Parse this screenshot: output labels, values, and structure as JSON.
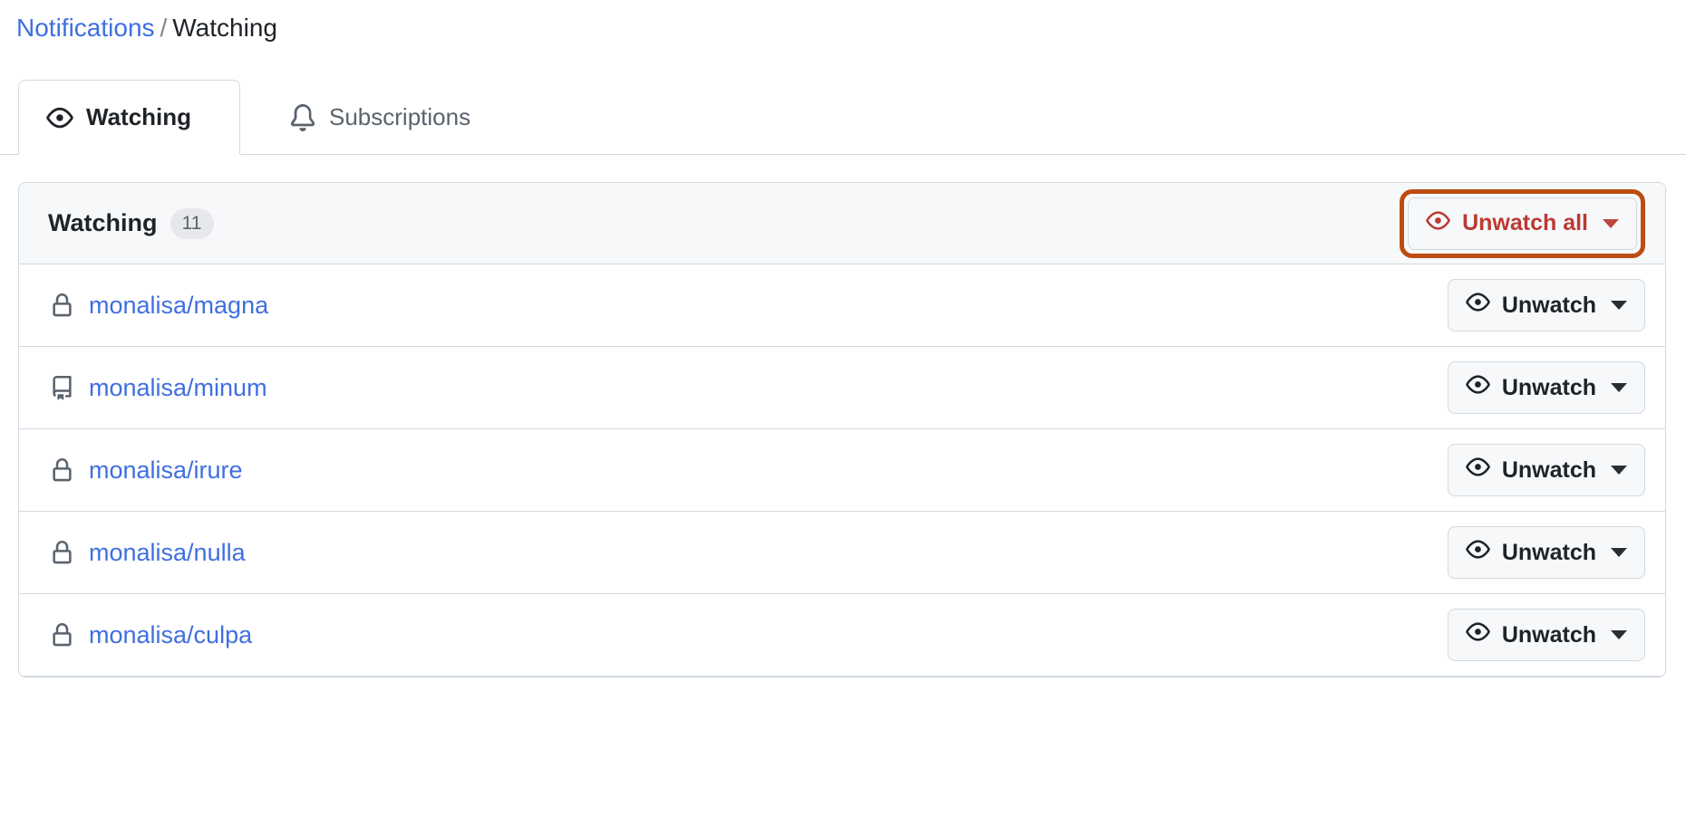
{
  "breadcrumb": {
    "parent": "Notifications",
    "separator": "/",
    "current": "Watching"
  },
  "tabs": [
    {
      "label": "Watching",
      "icon": "eye-icon",
      "selected": true
    },
    {
      "label": "Subscriptions",
      "icon": "bell-icon",
      "selected": false
    }
  ],
  "box": {
    "title": "Watching",
    "count": "11",
    "unwatch_all": {
      "label": "Unwatch all",
      "icon": "eye-icon",
      "caret": "chevron-down-icon",
      "focused": true,
      "text_color": "#bc3a32",
      "focus_ring_color": "#bc4c12"
    },
    "row_action": {
      "label": "Unwatch",
      "icon": "eye-icon",
      "caret": "chevron-down-icon"
    }
  },
  "repositories": [
    {
      "name": "monalisa/magna",
      "visibility": "private",
      "icon": "lock-icon"
    },
    {
      "name": "monalisa/minum",
      "visibility": "public",
      "icon": "repo-icon"
    },
    {
      "name": "monalisa/irure",
      "visibility": "private",
      "icon": "lock-icon"
    },
    {
      "name": "monalisa/nulla",
      "visibility": "private",
      "icon": "lock-icon"
    },
    {
      "name": "monalisa/culpa",
      "visibility": "private",
      "icon": "lock-icon"
    }
  ],
  "colors": {
    "link": "#3f6fe0",
    "text": "#1f2328",
    "muted": "#59636e",
    "border": "#d1d9e0",
    "header_bg": "#f6f8fa"
  }
}
